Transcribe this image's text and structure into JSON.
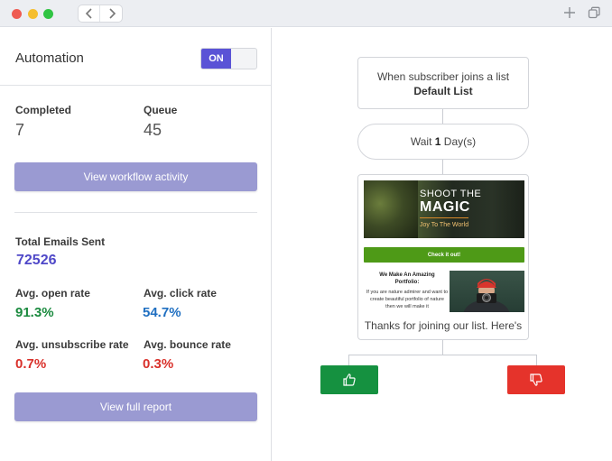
{
  "window": {
    "back_icon": "chevron-left-icon",
    "forward_icon": "chevron-right-icon",
    "new_tab_icon": "plus-icon",
    "tabs_icon": "copy-icon"
  },
  "sidebar": {
    "automation_label": "Automation",
    "toggle_state": "ON",
    "completed_label": "Completed",
    "completed_value": "7",
    "queue_label": "Queue",
    "queue_value": "45",
    "workflow_button": "View workflow activity",
    "total_sent_label": "Total Emails Sent",
    "total_sent_value": "72526",
    "open_rate_label": "Avg. open rate",
    "open_rate_value": "91.3%",
    "click_rate_label": "Avg. click rate",
    "click_rate_value": "54.7%",
    "unsubscribe_label": "Avg. unsubscribe rate",
    "unsubscribe_value": "0.7%",
    "bounce_label": "Avg. bounce rate",
    "bounce_value": "0.3%",
    "report_button": "View full report"
  },
  "flow": {
    "trigger_line1": "When subscriber joins a list",
    "trigger_line2": "Default List",
    "wait_prefix": "Wait ",
    "wait_count": "1",
    "wait_suffix": " Day(s)",
    "email": {
      "hero_line1": "SHOOT THE",
      "hero_line2": "MAGIC",
      "hero_line3": "Joy To The World",
      "cta": "Check it out!",
      "promo_title": "We Make An Amazing Portfolio:",
      "promo_body": "If you are nature admirer and want to create beautiful portfolio of nature then we will make it",
      "preview": "Thanks for joining our list. Here's"
    },
    "positive_icon": "thumbs-up-icon",
    "negative_icon": "thumbs-down-icon"
  },
  "colors": {
    "accent": "#5a53d6",
    "button_purple": "#9a9ad2",
    "total_sent": "#4f48c8",
    "open_rate": "#1a8a3e",
    "click_rate": "#1f6fc1",
    "unsubscribe": "#d9302a",
    "bounce": "#d9302a",
    "thumb_up": "#159140",
    "thumb_down": "#e5332b"
  }
}
